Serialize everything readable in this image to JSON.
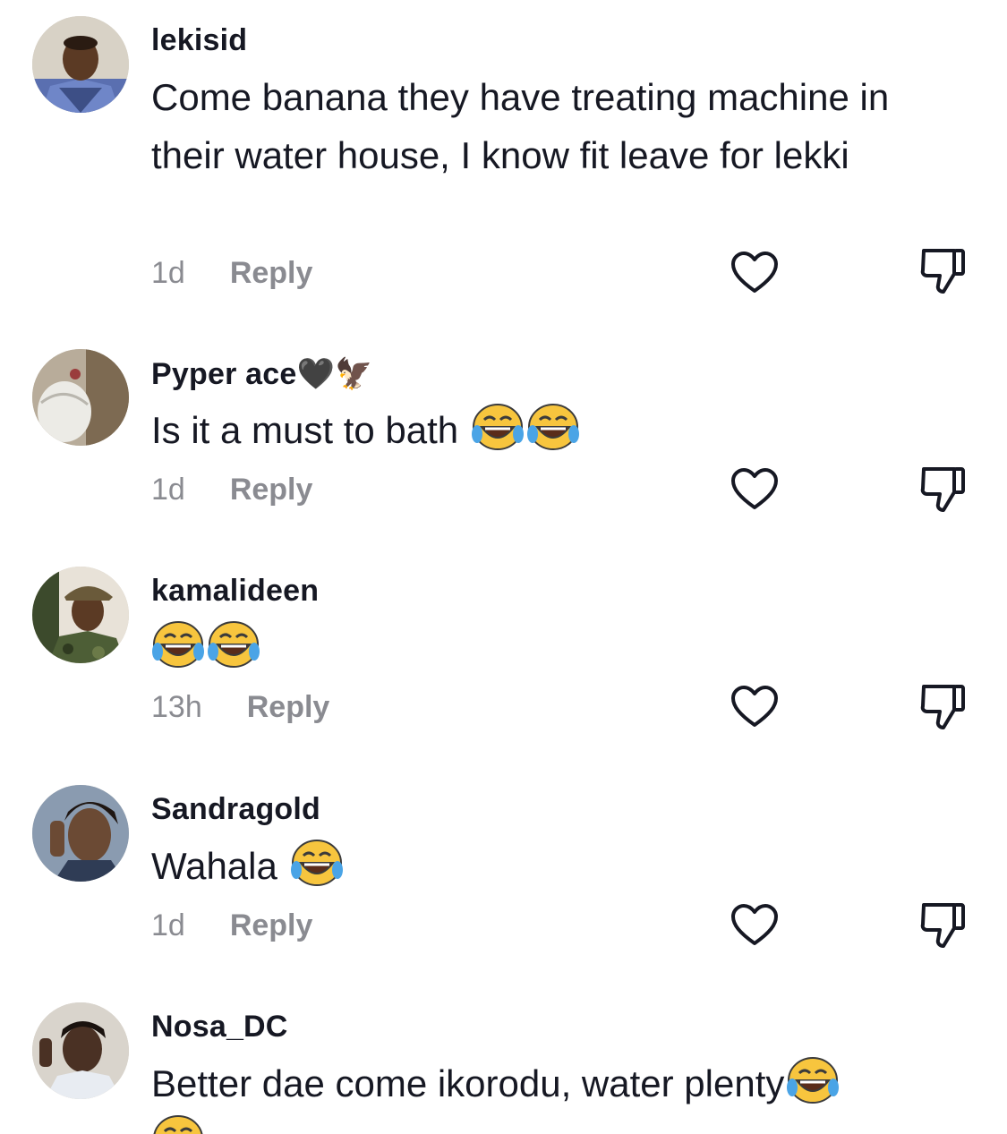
{
  "comments": [
    {
      "username": "lekisid",
      "text": "Come banana they have treating machine in their water house, I know fit leave for lekki",
      "time": "1d",
      "reply_label": "Reply"
    },
    {
      "username": "Pyper ace🖤🦅",
      "text": "Is it a must to bath",
      "emoji_count": 2,
      "time": "1d",
      "reply_label": "Reply"
    },
    {
      "username": "kamalideen",
      "text": "",
      "emoji_count": 2,
      "time": "13h",
      "reply_label": "Reply"
    },
    {
      "username": "Sandragold",
      "text": "Wahala",
      "emoji_count": 1,
      "time": "1d",
      "reply_label": "Reply"
    },
    {
      "username": "Nosa_DC",
      "text": "Better dae come ikorodu, water plenty",
      "emoji_count": 1,
      "time": "",
      "reply_label": ""
    }
  ],
  "icons": {
    "like": "heart-outline-icon",
    "dislike": "thumbs-down-outline-icon",
    "emoji": "face-with-tears-of-joy-emoji"
  },
  "colors": {
    "text": "#161823",
    "meta": "#8a8b91",
    "background": "#ffffff"
  }
}
